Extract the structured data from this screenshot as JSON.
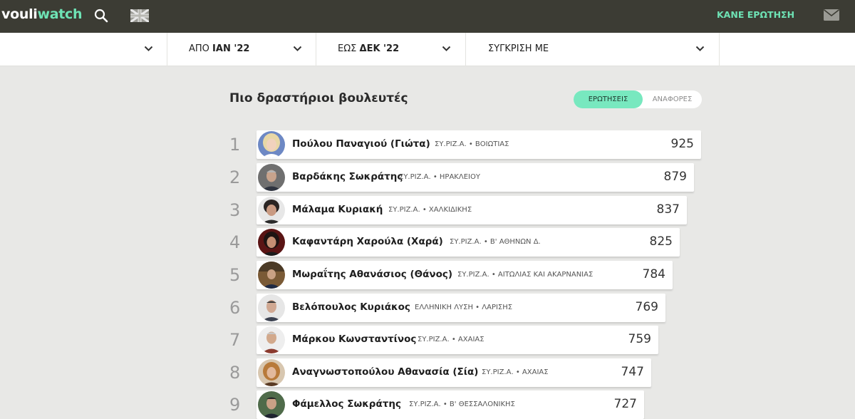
{
  "header": {
    "logo_part1": "vouli",
    "logo_part2": "watch",
    "ask_label": "ΚΑΝΕ ΕΡΩΤΗΣΗ",
    "icons": [
      "search-icon",
      "uk-flag-icon",
      "mail-icon"
    ]
  },
  "filters": {
    "from_prefix": "ΑΠΟ",
    "from_value": "ΙΑΝ '22",
    "to_prefix": "ΕΩΣ",
    "to_value": "ΔΕΚ '22",
    "compare_label": "ΣΥΓΚΡΙΣΗ ΜΕ"
  },
  "main": {
    "title": "Πιο δραστήριοι βουλευτές",
    "tabs": [
      {
        "label": "ΕΡΩΤΗΣΕΙΣ",
        "active": true
      },
      {
        "label": "ΑΝΑΦΟΡΕΣ",
        "active": false
      }
    ]
  },
  "colors": {
    "topbar": "#3c3c34",
    "accent": "#6ee3b5",
    "background": "#e8e8e6"
  },
  "mps": [
    {
      "rank": "1",
      "name": "Πούλου Παναγιού (Γιώτα)",
      "party": "ΣΥ.ΡΙΖ.Α.",
      "region": "ΒΟΙΩΤΙΑΣ",
      "count": "925"
    },
    {
      "rank": "2",
      "name": "Βαρδάκης Σωκράτης",
      "party": "ΣΥ.ΡΙΖ.Α.",
      "region": "ΗΡΑΚΛΕΙΟΥ",
      "count": "879"
    },
    {
      "rank": "3",
      "name": "Μάλαμα Κυριακή",
      "party": "ΣΥ.ΡΙΖ.Α.",
      "region": "ΧΑΛΚΙΔΙΚΗΣ",
      "count": "837"
    },
    {
      "rank": "4",
      "name": "Καφαντάρη Χαρούλα (Χαρά)",
      "party": "ΣΥ.ΡΙΖ.Α.",
      "region": "Β' ΑΘΗΝΩΝ Δ.",
      "count": "825"
    },
    {
      "rank": "5",
      "name": "Μωραΐτης Αθανάσιος (Θάνος)",
      "party": "ΣΥ.ΡΙΖ.Α.",
      "region": "ΑΙΤΩΛΙΑΣ ΚΑΙ ΑΚΑΡΝΑΝΙΑΣ",
      "count": "784"
    },
    {
      "rank": "6",
      "name": "Βελόπουλος Κυριάκος",
      "party": "ΕΛΛΗΝΙΚΗ ΛΥΣΗ",
      "region": "ΛΑΡΙΣΗΣ",
      "count": "769"
    },
    {
      "rank": "7",
      "name": "Μάρκου Κωνσταντίνος",
      "party": "ΣΥ.ΡΙΖ.Α.",
      "region": "ΑΧΑΙΑΣ",
      "count": "759"
    },
    {
      "rank": "8",
      "name": "Αναγνωστοπούλου Αθανασία (Σία)",
      "party": "ΣΥ.ΡΙΖ.Α.",
      "region": "ΑΧΑΙΑΣ",
      "count": "747"
    },
    {
      "rank": "9",
      "name": "Φάμελλος Σωκράτης",
      "party": "ΣΥ.ΡΙΖ.Α.",
      "region": "Β' ΘΕΣΣΑΛΟΝΙΚΗΣ",
      "count": "727"
    }
  ]
}
